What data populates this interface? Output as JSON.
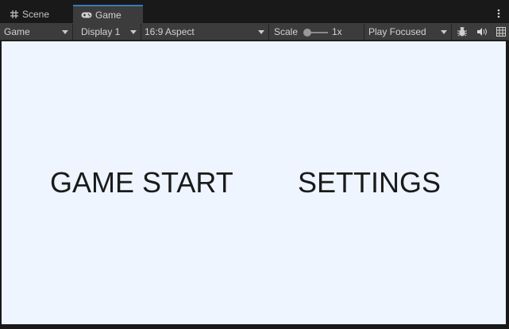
{
  "tabs": [
    {
      "label": "Scene",
      "icon": "grid-icon",
      "active": false
    },
    {
      "label": "Game",
      "icon": "gamepad-icon",
      "active": true
    }
  ],
  "toolbar": {
    "view_mode": "Game",
    "display": "Display 1",
    "aspect": "16:9 Aspect",
    "scale_label": "Scale",
    "scale_value": "1x",
    "play_mode": "Play Focused",
    "icons": [
      "bug-icon",
      "speaker-icon",
      "stats-icon"
    ]
  },
  "game": {
    "start_label": "GAME START",
    "settings_label": "SETTINGS",
    "background": "#eef5ff"
  },
  "colors": {
    "active_tab_accent": "#3a79bb",
    "panel": "#3c3c3c",
    "frame": "#191919"
  }
}
